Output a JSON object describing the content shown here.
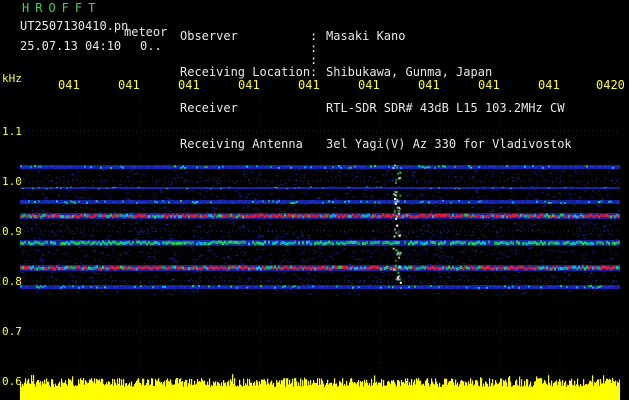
{
  "header": {
    "brand": "HROFFT",
    "filename": "UT2507130410.pn",
    "suffix": "meteor",
    "datetime": "25.07.13 04:10",
    "count": "0..",
    "info": [
      {
        "label": "Observer",
        "value": "Masaki Kano"
      },
      {
        "label": "Receiving Location",
        "value": "Shibukawa, Gunma, Japan"
      },
      {
        "label": "Receiver",
        "value": "RTL-SDR SDR# 43dB L15 103.2MHz CW"
      },
      {
        "label": "Receiving Antenna",
        "value": "3el Yagi(V) Az 330 for Vladivostok"
      }
    ]
  },
  "axis": {
    "unit": "kHz",
    "y_ticks": [
      "1.1",
      "1.0",
      "0.9",
      "0.8",
      "0.7",
      "0.6"
    ],
    "time_ticks": [
      "041",
      "041",
      "041",
      "041",
      "041",
      "041",
      "041",
      "041",
      "041",
      "0420"
    ]
  },
  "colors": {
    "background": "#000000",
    "text_green": "#3cd25a",
    "text_yellow": "#ffff2a",
    "noise_blue": "#1e2fd6",
    "signal_red": "#ff2020",
    "signal_green": "#22e040",
    "level_yellow": "#ffff00"
  }
}
